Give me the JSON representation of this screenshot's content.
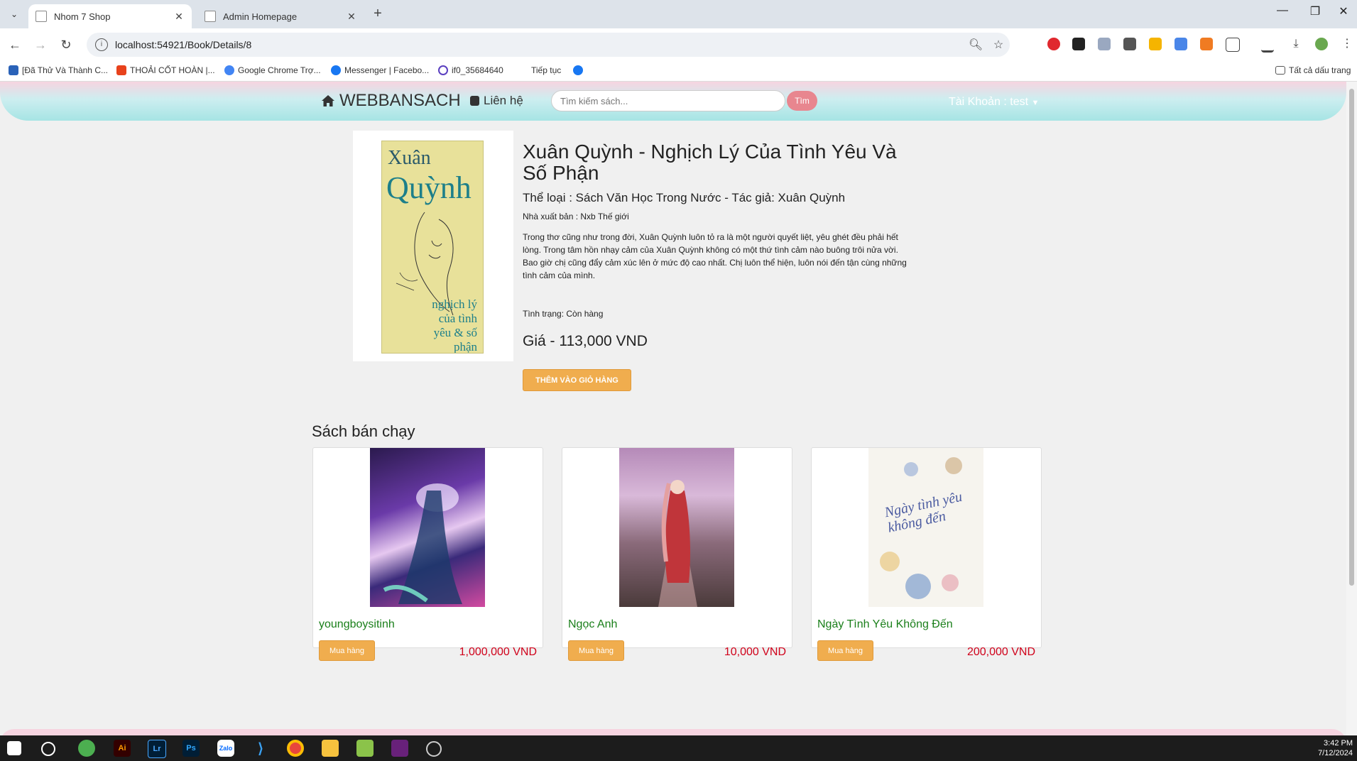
{
  "browser": {
    "tabs": [
      {
        "title": "Nhom 7 Shop",
        "active": true
      },
      {
        "title": "Admin Homepage",
        "active": false
      }
    ],
    "url": "localhost:54921/Book/Details/8",
    "bookmarks": [
      "[Đã Thử Và Thành C...",
      "THOẢI CỐT HOÀN |...",
      "Google Chrome Trợ...",
      "Messenger | Facebo...",
      "if0_35684640",
      "Tiếp tục"
    ],
    "all_bookmarks": "Tất cả dấu trang"
  },
  "nav": {
    "brand": "WEBBANSACH",
    "contact": "Liên hệ",
    "search_placeholder": "Tìm kiếm sách...",
    "search_button": "Tìm",
    "account": "Tài Khoản : test"
  },
  "product": {
    "title": "Xuân Quỳnh - Nghịch Lý Của Tình Yêu Và Số Phận",
    "meta": "Thể loại : Sách Văn Học Trong Nước - Tác giả: Xuân Quỳnh",
    "publisher": "Nhà xuất bản : Nxb Thế giới",
    "description": "Trong thơ cũng như trong đời, Xuân Quỳnh luôn tỏ ra là một người quyết liệt, yêu ghét đều phải hết lòng. Trong tâm hồn nhạy cảm của Xuân Quỳnh không có một thứ tình cảm nào buông trôi nửa vời. Bao giờ chị cũng đẩy cảm xúc lên ở mức độ cao nhất. Chị luôn thể hiện, luôn nói đến tận cùng những tình cảm của mình.",
    "status": "Tình trạng: Còn hàng",
    "price": "Giá - 113,000 VND",
    "add_to_cart": "THÊM VÀO GIỎ HÀNG",
    "cover": {
      "line1": "Xuân",
      "line2": "Quỳnh",
      "line3": "nghịch lý của tình yêu & số phận"
    }
  },
  "bestsellers": {
    "heading": "Sách bán chạy",
    "items": [
      {
        "name": "youngboysitinh",
        "price": "1,000,000 VND",
        "button": "Mua hàng"
      },
      {
        "name": "Ngọc Anh",
        "price": "10,000 VND",
        "button": "Mua hàng"
      },
      {
        "name": "Ngày Tình Yêu Không Đến",
        "price": "200,000 VND",
        "button": "Mua hàng",
        "cover_text": "Ngày tình yêu không đến"
      }
    ]
  },
  "taskbar": {
    "time": "3:42 PM",
    "date": "7/12/2024"
  }
}
